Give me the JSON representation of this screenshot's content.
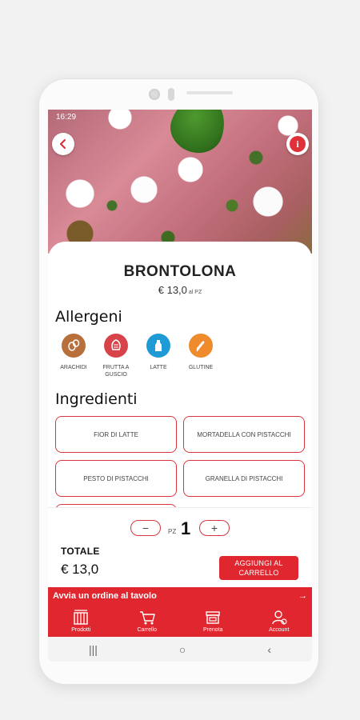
{
  "status_bar": {
    "time": "16:29",
    "right": ""
  },
  "product": {
    "name": "BRONTOLONA",
    "price": "€ 13,0",
    "price_unit": "al PZ"
  },
  "allergens": {
    "title": "Allergeni",
    "items": [
      {
        "label": "ARACHIDI",
        "icon": "peanut-icon",
        "color": "#b86f3c"
      },
      {
        "label": "FRUTTA A GUSCIO",
        "icon": "nut-icon",
        "color": "#d8434b"
      },
      {
        "label": "LATTE",
        "icon": "milk-icon",
        "color": "#1e9ad6"
      },
      {
        "label": "GLUTINE",
        "icon": "wheat-icon",
        "color": "#ef8a2d"
      }
    ]
  },
  "ingredients": {
    "title": "Ingredienti",
    "items": [
      "FIOR DI LATTE",
      "MORTADELLA CON PISTACCHI",
      "PESTO DI PISTACCHI",
      "GRANELLA DI PISTACCHI"
    ]
  },
  "order": {
    "minus": "−",
    "plus": "+",
    "qty_unit": "PZ",
    "qty": "1",
    "total_label": "TOTALE",
    "total_value": "€ 13,0",
    "add_button": "AGGIUNGI AL CARRELLO"
  },
  "order_bar": {
    "label": "Avvia un ordine al tavolo",
    "arrow": "→"
  },
  "tabs": [
    {
      "label": "Prodotti",
      "icon": "products-icon"
    },
    {
      "label": "Carrello",
      "icon": "cart-icon"
    },
    {
      "label": "Prenota",
      "icon": "store-icon"
    },
    {
      "label": "Account",
      "icon": "account-icon"
    }
  ],
  "system_nav": {
    "recents": "|||",
    "home": "○",
    "back": "‹"
  },
  "colors": {
    "accent": "#e0262e",
    "outline": "#d9363e"
  }
}
